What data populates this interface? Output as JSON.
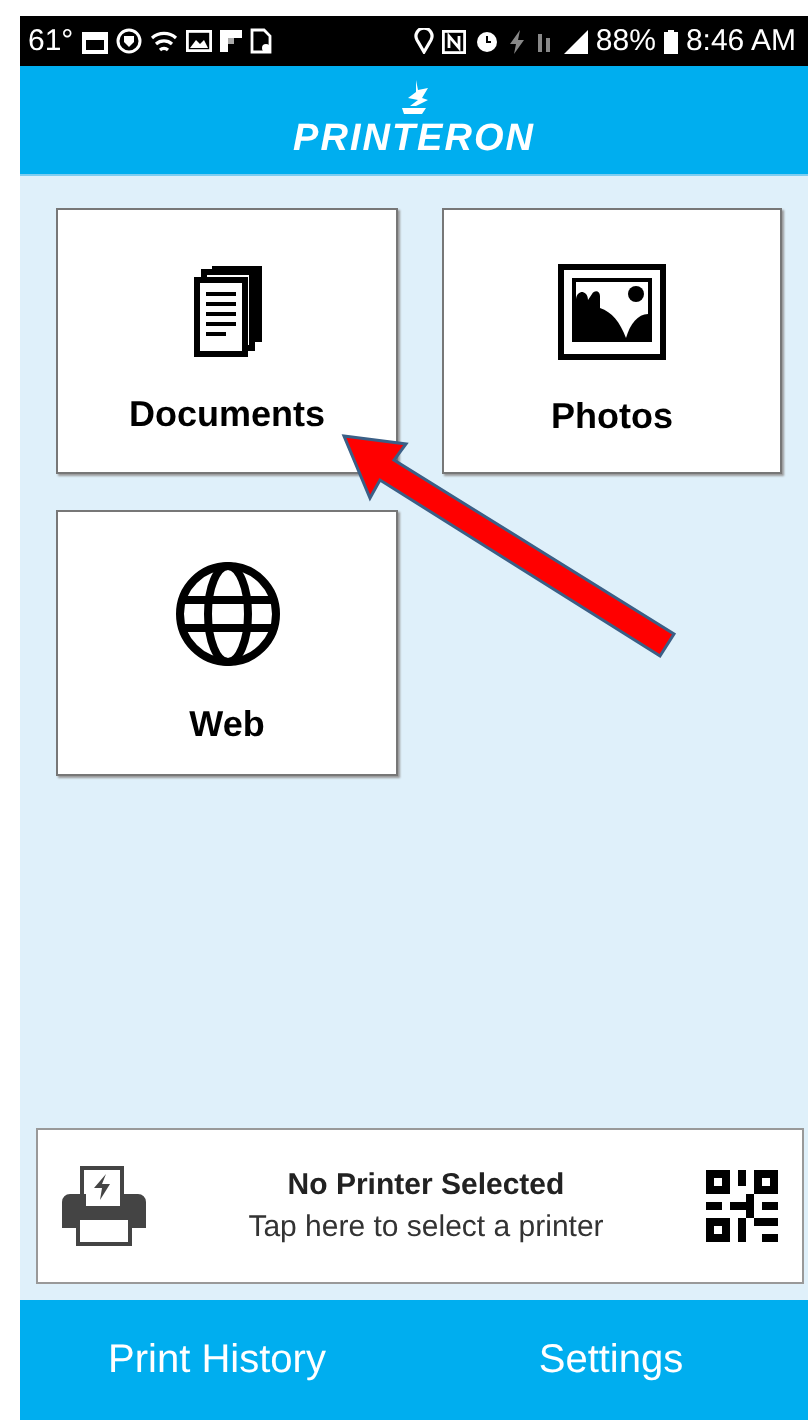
{
  "status_bar": {
    "temperature": "61°",
    "battery": "88%",
    "time": "8:46 AM"
  },
  "header": {
    "logo": "PRINTERON"
  },
  "tiles": [
    {
      "kind": "documents",
      "label": "Documents"
    },
    {
      "kind": "photos",
      "label": "Photos"
    },
    {
      "kind": "web",
      "label": "Web"
    }
  ],
  "printer_card": {
    "title": "No Printer Selected",
    "subtitle": "Tap here to select a printer"
  },
  "bottom_nav": [
    "Print History",
    "Settings"
  ]
}
